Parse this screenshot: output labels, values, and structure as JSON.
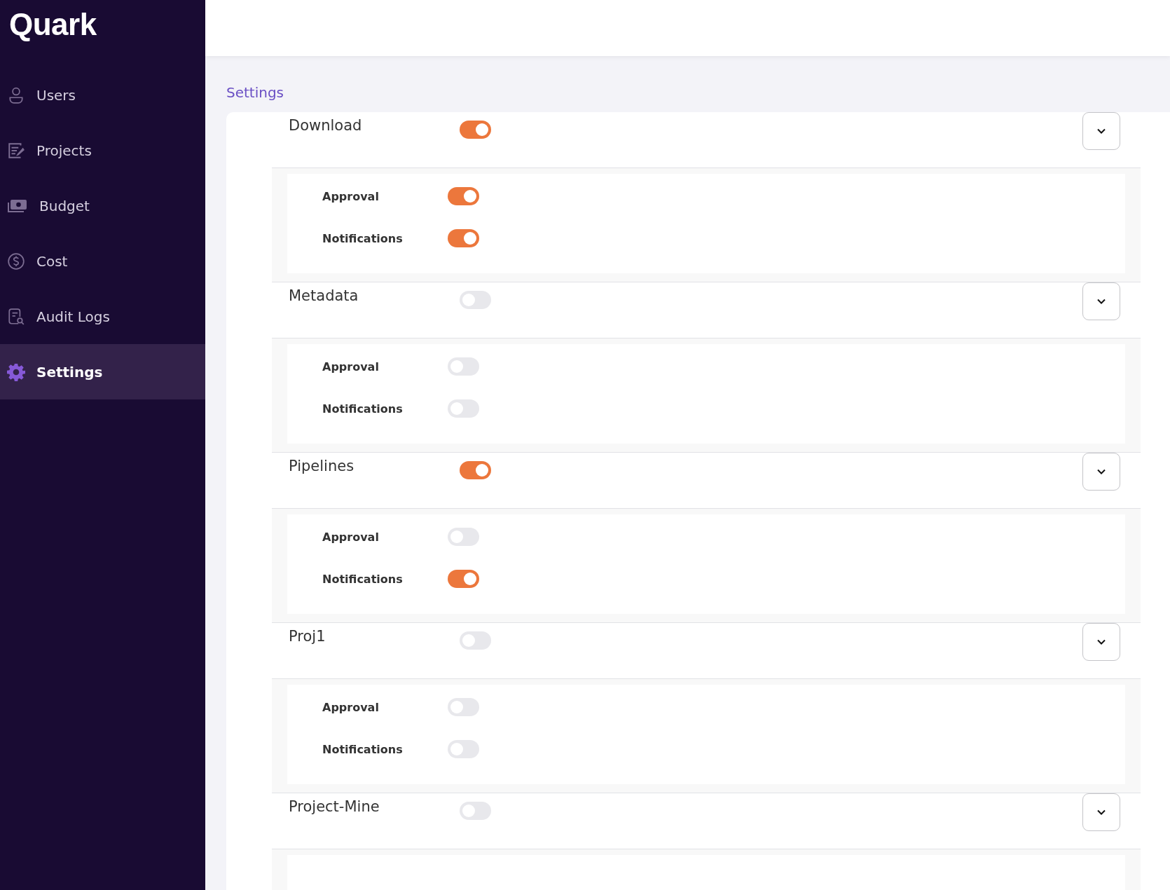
{
  "sidebar": {
    "logo": "Quark",
    "items": [
      {
        "label": "Users",
        "kind": "user",
        "selected": false
      },
      {
        "label": "Projects",
        "kind": "projects",
        "selected": false
      },
      {
        "label": "Budget",
        "kind": "budget",
        "selected": false
      },
      {
        "label": "Cost",
        "kind": "cost",
        "selected": false
      },
      {
        "label": "Audit Logs",
        "kind": "audit",
        "selected": false
      },
      {
        "label": "Settings",
        "kind": "gear",
        "selected": true
      }
    ]
  },
  "page_title": "Settings",
  "sections": [
    {
      "name": "Download",
      "on": true,
      "settings": [
        {
          "label": "Approval",
          "on": true
        },
        {
          "label": "Notifications",
          "on": true
        }
      ]
    },
    {
      "name": "Metadata",
      "on": false,
      "settings": [
        {
          "label": "Approval",
          "on": false
        },
        {
          "label": "Notifications",
          "on": false
        }
      ]
    },
    {
      "name": "Pipelines",
      "on": true,
      "settings": [
        {
          "label": "Approval",
          "on": false
        },
        {
          "label": "Notifications",
          "on": true
        }
      ]
    },
    {
      "name": "Proj1",
      "on": false,
      "settings": [
        {
          "label": "Approval",
          "on": false
        },
        {
          "label": "Notifications",
          "on": false
        }
      ]
    },
    {
      "name": "Project-Mine",
      "on": false
    }
  ]
}
